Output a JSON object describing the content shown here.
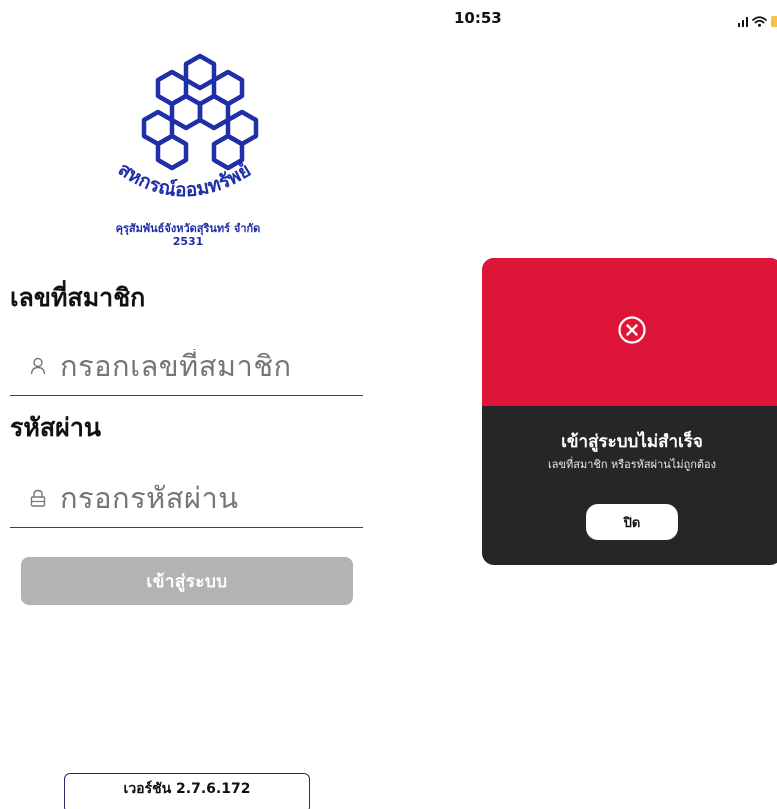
{
  "login": {
    "org_name_line1": "คุรุสัมพันธ์จังหวัดสุรินทร์ จำกัด",
    "org_name_line2": "2531",
    "logo_arc_text": "สหกรณ์ออมทรัพย์",
    "member_label": "เลขที่สมาชิก",
    "member_placeholder": "กรอกเลขที่สมาชิก",
    "member_icon": "user-icon",
    "password_label": "รหัสผ่าน",
    "password_placeholder": "กรอกรหัสผ่าน",
    "password_icon": "lock-icon",
    "login_button": "เข้าสู่ระบบ",
    "version": "เวอร์ชัน 2.7.6.172"
  },
  "status_bar": {
    "time": "10:53"
  },
  "error_modal": {
    "icon": "close-circle-icon",
    "title": "เข้าสู่ระบบไม่สำเร็จ",
    "message": "เลขที่สมาชิก หรือรหัสผ่านไม่ถูกต้อง",
    "close_button": "ปิด"
  },
  "colors": {
    "brand_blue": "#1f2fa8",
    "error_red": "#de1438",
    "modal_dark": "#262626",
    "disabled_button": "#b3b3b3"
  }
}
